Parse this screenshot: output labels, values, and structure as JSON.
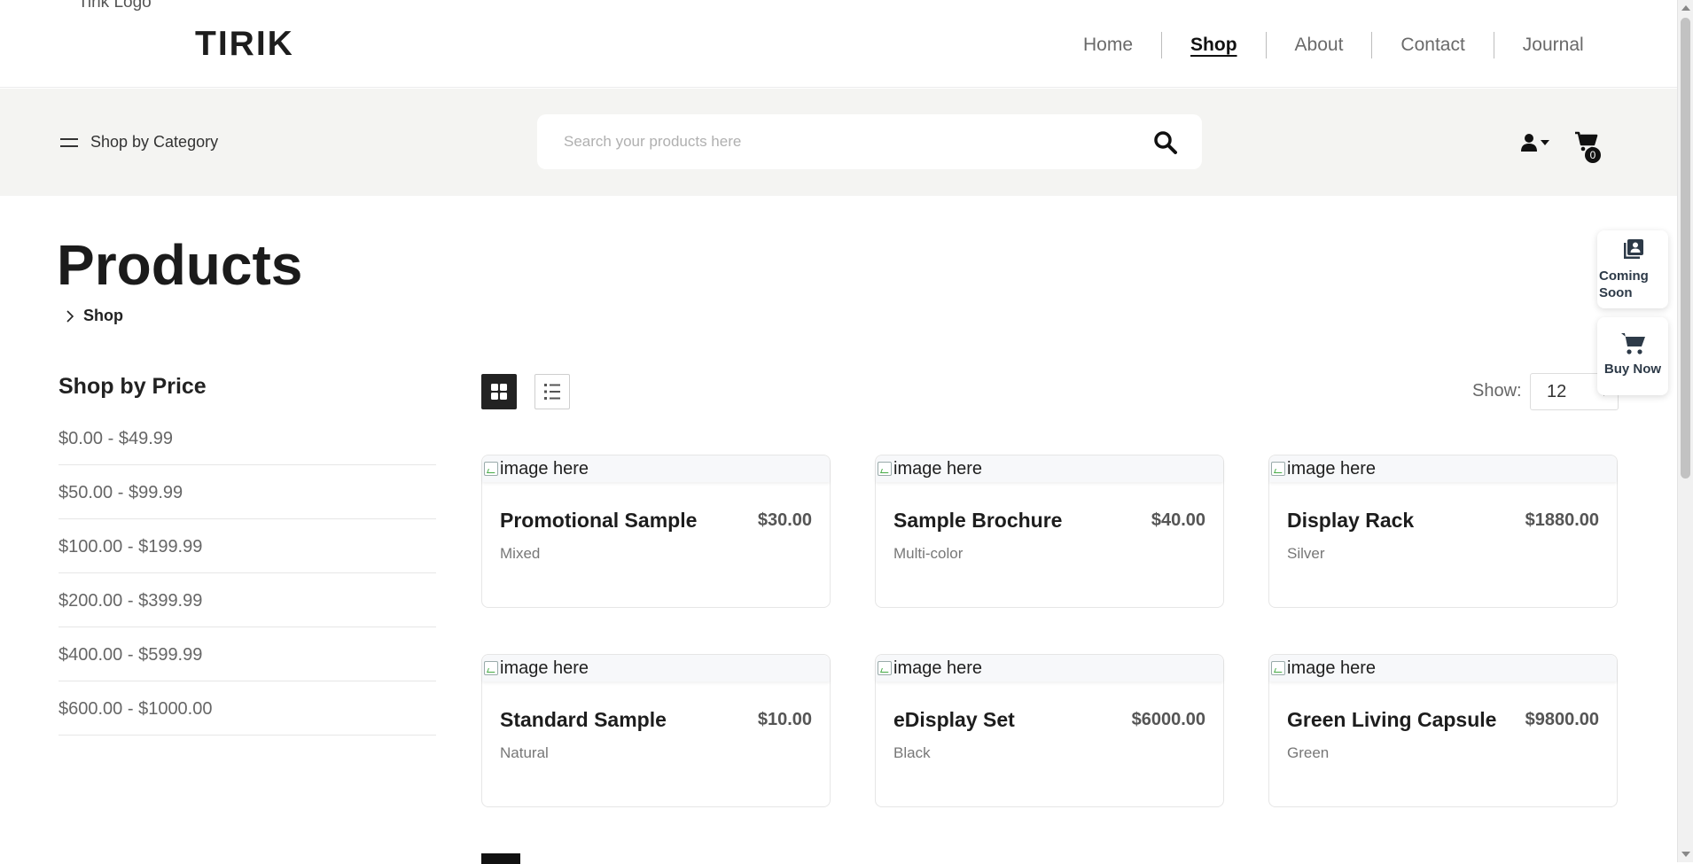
{
  "header": {
    "logo_alt": "Tirik Logo",
    "logo": "TIRIK",
    "nav": [
      {
        "label": "Home",
        "active": false
      },
      {
        "label": "Shop",
        "active": true
      },
      {
        "label": "About",
        "active": false
      },
      {
        "label": "Contact",
        "active": false
      },
      {
        "label": "Journal",
        "active": false
      }
    ]
  },
  "searchbar": {
    "category_label": "Shop by Category",
    "placeholder": "Search your products here",
    "cart_count": "0"
  },
  "page": {
    "title": "Products",
    "breadcrumb": "Shop"
  },
  "sidebar": {
    "title": "Shop by Price",
    "ranges": [
      "$0.00 - $49.99",
      "$50.00 - $99.99",
      "$100.00 - $199.99",
      "$200.00 - $399.99",
      "$400.00 - $599.99",
      "$600.00 - $1000.00"
    ]
  },
  "toolbar": {
    "show_label": "Show:",
    "show_value": "12"
  },
  "products": [
    {
      "image_alt": "image here",
      "name": "Promotional Sample",
      "price": "$30.00",
      "variant": "Mixed"
    },
    {
      "image_alt": "image here",
      "name": "Sample Brochure",
      "price": "$40.00",
      "variant": "Multi-color"
    },
    {
      "image_alt": "image here",
      "name": "Display Rack",
      "price": "$1880.00",
      "variant": "Silver"
    },
    {
      "image_alt": "image here",
      "name": "Standard Sample",
      "price": "$10.00",
      "variant": "Natural"
    },
    {
      "image_alt": "image here",
      "name": "eDisplay Set",
      "price": "$6000.00",
      "variant": "Black"
    },
    {
      "image_alt": "image here",
      "name": "Green Living Capsule",
      "price": "$9800.00",
      "variant": "Green"
    }
  ],
  "widgets": {
    "coming_soon": "Coming Soon",
    "buy_now": "Buy Now"
  },
  "colors": {
    "band_bg": "#f4f4f2",
    "text_dark": "#1d1d1d",
    "widget_text": "#2d3a48"
  }
}
